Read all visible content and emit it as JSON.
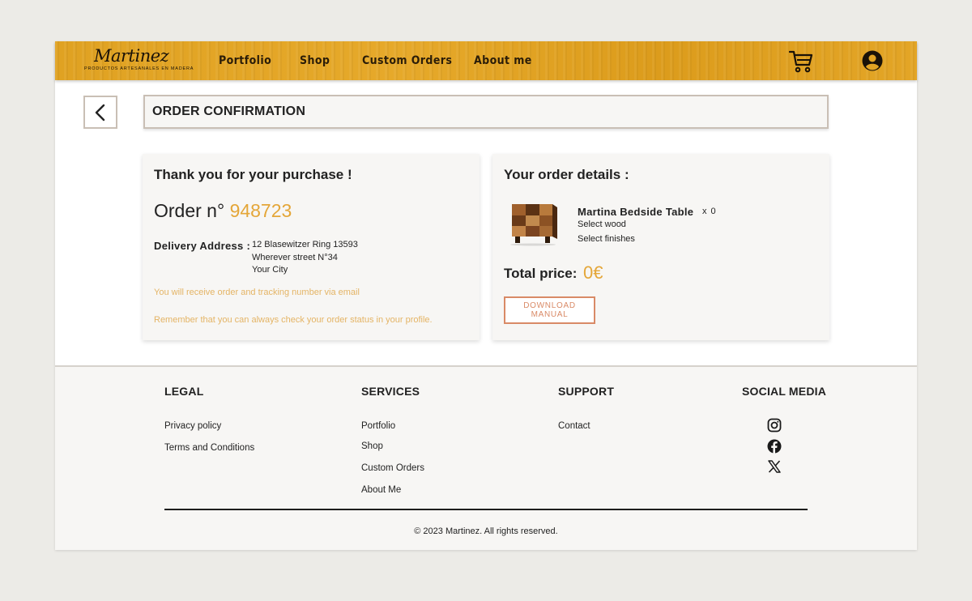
{
  "brand": {
    "logo_text": "Martinez",
    "tagline": "PRODUCTOS ARTESANALES EN MADERA"
  },
  "nav": {
    "items": [
      {
        "label": "Portfolio"
      },
      {
        "label": "Shop"
      },
      {
        "label": "Custom Orders"
      },
      {
        "label": "About me"
      }
    ],
    "icons": [
      "cart-icon",
      "user-account-icon"
    ]
  },
  "page": {
    "title": "ORDER CONFIRMATION",
    "back_icon": "chevron-left-icon"
  },
  "confirmation": {
    "heading": "Thank you for your purchase !",
    "order_label": "Order n°",
    "order_number": "948723",
    "address_label": "Delivery Address :",
    "address_lines": [
      "12 Blasewitzer Ring 13593",
      "Wherever street N°34",
      "Your City"
    ],
    "note_tracking": "You will receive order and tracking number via email",
    "note_profile": "Remember that you can always check your order status in your profile."
  },
  "order_details": {
    "heading": "Your order details :",
    "product": {
      "name": "Martina Bedside Table",
      "quantity": "x 0",
      "option_wood": "Select wood",
      "option_finish": "Select finishes"
    },
    "total_label": "Total price:",
    "total_value": "0€",
    "download_label": "DOWNLOAD MANUAL"
  },
  "footer": {
    "legal": {
      "heading": "LEGAL",
      "links": [
        "Privacy policy",
        "Terms and Conditions"
      ]
    },
    "services": {
      "heading": "SERVICES",
      "links": [
        "Portfolio",
        "Shop",
        "Custom Orders",
        "About Me"
      ]
    },
    "support": {
      "heading": "SUPPORT",
      "links": [
        "Contact"
      ]
    },
    "social": {
      "heading": "SOCIAL MEDIA",
      "icons": [
        "instagram-icon",
        "facebook-icon",
        "x-twitter-icon"
      ]
    },
    "copyright": "© 2023 Martinez. All rights reserved."
  },
  "colors": {
    "nav_bg": "#e2a424",
    "accent": "#e4a638",
    "button_border": "#d98a66",
    "page_bg": "#ecebe7",
    "card_bg": "#f7f6f4"
  }
}
